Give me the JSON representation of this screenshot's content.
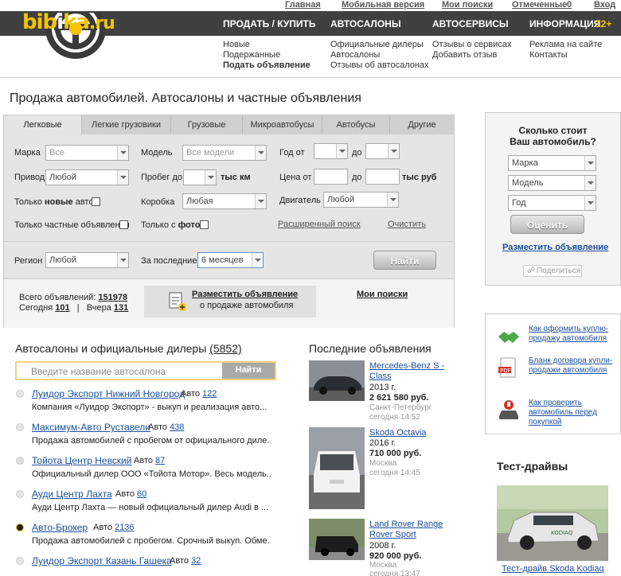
{
  "topbar": {
    "links": [
      "Главная",
      "Мобильная версия",
      "Мои поиски",
      "Отмеченные",
      "Вход"
    ],
    "marked_count": "0"
  },
  "logo": {
    "part1": "bib",
    "part2": "i",
    "part3": "ka",
    "part4": ".ru"
  },
  "nav": {
    "items": [
      "ПРОДАТЬ / КУПИТЬ",
      "АВТОСАЛОНЫ",
      "АВТОСЕРВИСЫ",
      "ИНФОРМАЦИЯ"
    ],
    "age_badge": "12+"
  },
  "subnav": {
    "col1": [
      "Новые",
      "Подержанные",
      "Подать объявление"
    ],
    "col2": [
      "Официальные дилеры",
      "Автосалоны",
      "Отзывы об автосалонах"
    ],
    "col3": [
      "Отзывы о сервисах",
      "Добавить отзыв"
    ],
    "col4": [
      "Реклама на сайте",
      "Контакты"
    ]
  },
  "page_title": "Продажа автомобилей. Автосалоны и частные объявления",
  "search": {
    "tabs": [
      "Легковые",
      "Легкие грузовики",
      "Грузовые",
      "Микроавтобусы",
      "Автобусы",
      "Другие"
    ],
    "brand_label": "Марка",
    "brand_value": "Все",
    "model_label": "Модель",
    "model_value": "Все модели",
    "year_label": "Год от",
    "year_to": "до",
    "drive_label": "Привод",
    "drive_value": "Любой",
    "mileage_label": "Пробег до",
    "mileage_unit": "тыс км",
    "price_label": "Цена от",
    "price_to": "до",
    "price_unit": "тыс руб",
    "only_new_pre": "Только ",
    "only_new_b": "новые",
    "only_new_post": " авто",
    "gearbox_label": "Коробка",
    "gearbox_value": "Любая",
    "engine_label": "Двигатель",
    "engine_value": "Любой",
    "only_private": "Только частные объявления",
    "only_photo_pre": "Только с ",
    "only_photo_b": "фото",
    "advanced_link": "Расширенный поиск",
    "clear_link": "Очистить",
    "region_label": "Регион",
    "region_value": "Любой",
    "period_label": "За последние",
    "period_value": "6 месяцев",
    "find_button": "Найти"
  },
  "stats": {
    "total_label": "Всего объявлений:",
    "total_value": "151978",
    "today_label": "Сегодня",
    "today_value": "101",
    "yesterday_label": "Вчера",
    "yesterday_value": "131",
    "post_title": "Разместить объявление",
    "post_sub": "о продаже автомобиля",
    "my_searches": "Мои поиски"
  },
  "dealers": {
    "heading": "Автосалоны и официальные дилеры",
    "count": "(5852)",
    "search_placeholder": "Введите название автосалона",
    "search_button": "Найти",
    "auto_label": "Авто",
    "items": [
      {
        "name": "Луидор Экспорт Нижний Новгород",
        "count": "122",
        "desc": "Компания «Луидор Экспорт» - выкуп и реализация авто..."
      },
      {
        "name": "Максимум-Авто Руставели",
        "count": "438",
        "desc": "Продажа автомобилей с пробегом от официального диле..."
      },
      {
        "name": "Тойота Центр Невский",
        "count": "87",
        "desc": "Официальный дилер ООО «Тойота Мотор». Весь модель..."
      },
      {
        "name": "Ауди Центр Лахта",
        "count": "60",
        "desc": "Ауди Центр Лахта — новый официальный дилер Audi в ..."
      },
      {
        "name": "Авто-Брокер",
        "count": "2136",
        "desc": "Продажа автомобилей с пробегом. Срочный выкуп. Обме..."
      },
      {
        "name": "Луидор Экспорт Казань Гашека",
        "count": "32",
        "desc": ""
      }
    ]
  },
  "latest": {
    "heading": "Последние объявления",
    "items": [
      {
        "title": "Mercedes-Benz S - Class",
        "year": "2013 г.",
        "price": "2 621 580 руб.",
        "city": "Санкт-Петербург",
        "time": "сегодня 14:52"
      },
      {
        "title": "Skoda Octavia",
        "year": "2016 г.",
        "price": "710 000 руб.",
        "city": "Москва",
        "time": "сегодня 14:45"
      },
      {
        "title": "Land Rover Range Rover Sport",
        "year": "2008 г.",
        "price": "920 000 руб.",
        "city": "Москва",
        "time": "сегодня 13:47"
      }
    ]
  },
  "valuation": {
    "title_line1": "Сколько стоит",
    "title_line2": "Ваш автомобиль?",
    "brand": "Марка",
    "model": "Модель",
    "year": "Год",
    "button": "Оценить",
    "post_link": "Разместить объявление",
    "share": "Поделиться"
  },
  "guides": [
    "Как оформить куплю-продажу автомобиля",
    "Бланк договора купли-продажи автомобиля",
    "Как проверить автомобиль перед покупкой"
  ],
  "testdrive": {
    "heading": "Тест-драйвы",
    "caption": "Тест-драйв Skoda Kodiaq",
    "plate": "KODIAQ"
  },
  "colors": {
    "accent": "#f5c400",
    "nav_bg": "#404040",
    "link": "#1a4fa0"
  }
}
